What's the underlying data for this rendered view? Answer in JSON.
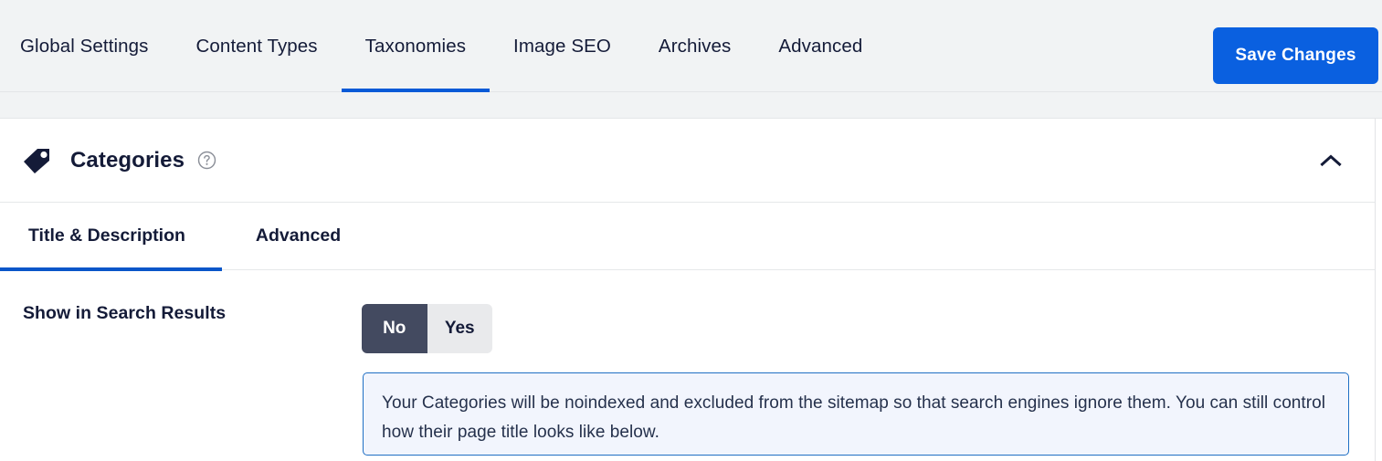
{
  "topnav": {
    "tabs": [
      {
        "label": "Global Settings",
        "active": false
      },
      {
        "label": "Content Types",
        "active": false
      },
      {
        "label": "Taxonomies",
        "active": true
      },
      {
        "label": "Image SEO",
        "active": false
      },
      {
        "label": "Archives",
        "active": false
      },
      {
        "label": "Advanced",
        "active": false
      }
    ],
    "save_label": "Save Changes",
    "accent_color": "#075ad7",
    "save_button_color": "#0a60e0"
  },
  "card": {
    "icon": "tag-icon",
    "title": "Categories",
    "help_icon": "help-circle-icon",
    "collapse_icon": "chevron-up-icon",
    "subtabs": [
      {
        "label": "Title & Description",
        "active": true
      },
      {
        "label": "Advanced",
        "active": false
      }
    ]
  },
  "setting": {
    "label": "Show in Search Results",
    "toggle": {
      "options": [
        {
          "label": "No",
          "selected": true
        },
        {
          "label": "Yes",
          "selected": false
        }
      ],
      "selected_color": "#434a60",
      "unselected_color": "#e9eaec"
    },
    "notice": {
      "text": "Your Categories will be noindexed and excluded from the sitemap so that search engines ignore them. You can still control how their page title looks like below.",
      "border_color": "#1f6fc4",
      "background_color": "#f2f5fd"
    }
  }
}
